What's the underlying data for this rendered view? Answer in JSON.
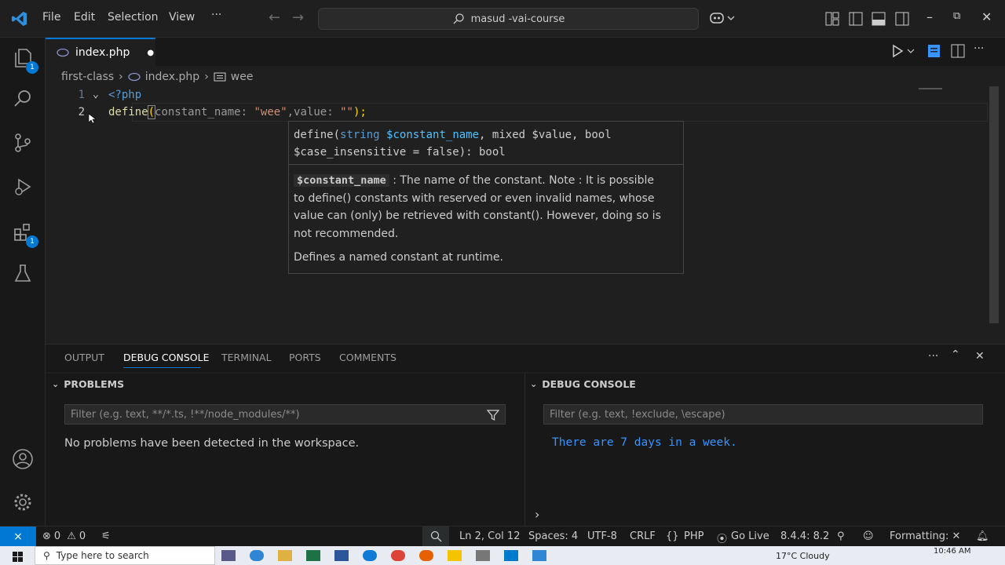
{
  "menu": [
    "File",
    "Edit",
    "Selection",
    "View",
    "···"
  ],
  "search": {
    "text": "masud -vai-course"
  },
  "activity": {
    "explorer_badge": "1",
    "extensions_badge": "1"
  },
  "tab": {
    "label": "index.php"
  },
  "breadcrumb": {
    "folder": "first-class",
    "file": "index.php",
    "symbol": "wee"
  },
  "code": {
    "line1_num": "1",
    "line1": "<?php",
    "line2_num": "2",
    "fn": "define",
    "p1": "constant_name:",
    "s1": "\"wee",
    "s1end": "\"",
    "p2": ",value:",
    "s2": "\"\"",
    "end": ");"
  },
  "hover": {
    "sig_l1_a": "define(",
    "sig_l1_b": "string",
    "sig_l1_c": "$constant_name",
    "sig_l1_d": ", mixed $value, bool",
    "sig_l2": "$case_insensitive = false): bool",
    "param": "$constant_name",
    "doc1_rest": " : The name of the constant. Note : It is possible",
    "doc2": "to define() constants with reserved or even invalid names, whose",
    "doc3": "value can (only) be retrieved with constant(). However, doing so is",
    "doc4": "not recommended.",
    "doc5": "Defines a named constant at runtime."
  },
  "panel": {
    "tabs": [
      "OUTPUT",
      "DEBUG CONSOLE",
      "TERMINAL",
      "PORTS",
      "COMMENTS"
    ],
    "problems_title": "PROBLEMS",
    "problems_filter": "Filter (e.g. text, **/*.ts, !**/node_modules/**)",
    "problems_message": "No problems have been detected in the workspace.",
    "debug_title": "DEBUG CONSOLE",
    "debug_filter": "Filter (e.g. text, !exclude, \\escape)",
    "debug_output": "There are 7 days in a week."
  },
  "status": {
    "errors": "0",
    "warnings": "0",
    "position": "Ln 2, Col 12",
    "spaces": "Spaces: 4",
    "encoding": "UTF-8",
    "eol": "CRLF",
    "language": "PHP",
    "golive": "Go Live",
    "version": "8.4.4: 8.2",
    "formatting": "Formatting: ✕"
  },
  "taskbar": {
    "search": "Type here to search",
    "weather": "17°C  Cloudy",
    "time": "10:46 AM"
  },
  "colors": {
    "accent": "#0078d4",
    "keyword": "#569cd6",
    "string": "#ce9178",
    "function": "#dcdcaa",
    "param": "#9cdcfe",
    "debug_text": "#3794ff"
  }
}
